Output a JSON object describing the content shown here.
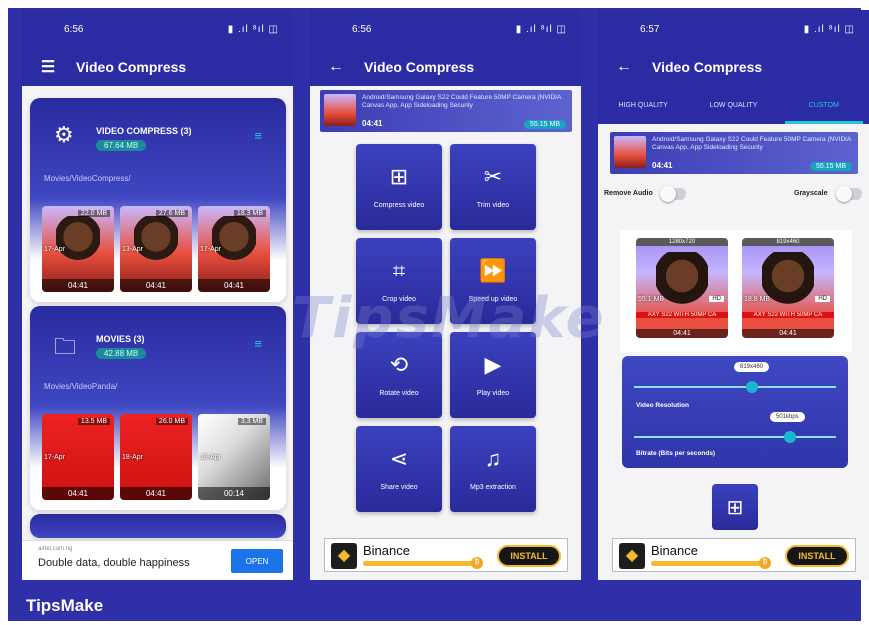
{
  "statusbar": {
    "time1": "6:56",
    "time2": "6:56",
    "time3": "6:57",
    "icons": "▶ ◆ •",
    "right_icons": "▮ .ıl ⁸ıl ◫"
  },
  "app": {
    "title": "Video Compress"
  },
  "phone1": {
    "folders": [
      {
        "name": "VIDEO COMPRESS (3)",
        "size": "67.64 MB",
        "path": "Movies/VideoCompress/",
        "thumbs": [
          {
            "size": "22.0 MB",
            "date": "17-Apr",
            "duration": "04:41",
            "style": "face"
          },
          {
            "size": "27.6 MB",
            "date": "13-Apr",
            "duration": "04:41",
            "style": "face"
          },
          {
            "size": "18.3 MB",
            "date": "17-Apr",
            "duration": "04:41",
            "style": "face"
          }
        ]
      },
      {
        "name": "MOVIES (3)",
        "size": "42.88 MB",
        "path": "Movies/VideoPanda/",
        "thumbs": [
          {
            "size": "13.5 MB",
            "date": "17-Apr",
            "duration": "04:41",
            "style": "red"
          },
          {
            "size": "26.0 MB",
            "date": "18-Apr",
            "duration": "04:41",
            "style": "red"
          },
          {
            "size": "3.3 MB",
            "date": "18-Apr",
            "duration": "00:14",
            "style": "paper"
          }
        ]
      }
    ],
    "ad": {
      "source": "airtel.com.ng",
      "text": "Double data, double happiness",
      "button": "OPEN"
    }
  },
  "video": {
    "title": "Android/Samsung Galaxy S22 Could Feature 50MP Camera (NVIDIA Canvas App, App Sideloading Security",
    "duration": "04:41",
    "size": "55.15 MB"
  },
  "phone2": {
    "tiles": [
      {
        "label": "Compress video",
        "icon": "compress-icon",
        "glyph": "⊞"
      },
      {
        "label": "Trim video",
        "icon": "scissors-icon",
        "glyph": "✂"
      },
      {
        "label": "Crop video",
        "icon": "crop-icon",
        "glyph": "⌗"
      },
      {
        "label": "Speed up video",
        "icon": "fast-forward-icon",
        "glyph": "⏩"
      },
      {
        "label": "Rotate video",
        "icon": "rotate-icon",
        "glyph": "⟲"
      },
      {
        "label": "Play video",
        "icon": "play-icon",
        "glyph": "▶"
      },
      {
        "label": "Share video",
        "icon": "share-icon",
        "glyph": "⋖"
      },
      {
        "label": "Mp3 extraction",
        "icon": "music-file-icon",
        "glyph": "♫"
      }
    ]
  },
  "binance": {
    "name": "Binance",
    "button": "INSTALL"
  },
  "phone3": {
    "tabs": [
      "HIGH QUALITY",
      "LOW QUALITY",
      "CUSTOM"
    ],
    "active_tab": "CUSTOM",
    "remove_audio": "Remove Audio",
    "grayscale": "Grayscale",
    "compare": [
      {
        "resolution": "1280x720",
        "size": "55.1 MB",
        "badge": "HD",
        "caption": "AXY S22 WITH 50MP CA",
        "duration": "04:41"
      },
      {
        "resolution": "819x460",
        "size": "18.8 MB",
        "badge": "HD",
        "caption": "AXY S22 WITH 50MP CA",
        "duration": "04:41"
      }
    ],
    "resolution_label": "Video Resolution",
    "resolution_value": "819x460",
    "bitrate_label": "Bitrate (Bits per seconds)",
    "bitrate_value": "501kbps"
  },
  "footer": {
    "brand": "TipsMake"
  },
  "watermark": "TipsMake",
  "colors": {
    "primary": "#2b2ba3",
    "accent": "#23c7e0",
    "binance": "#f3ba2f"
  }
}
